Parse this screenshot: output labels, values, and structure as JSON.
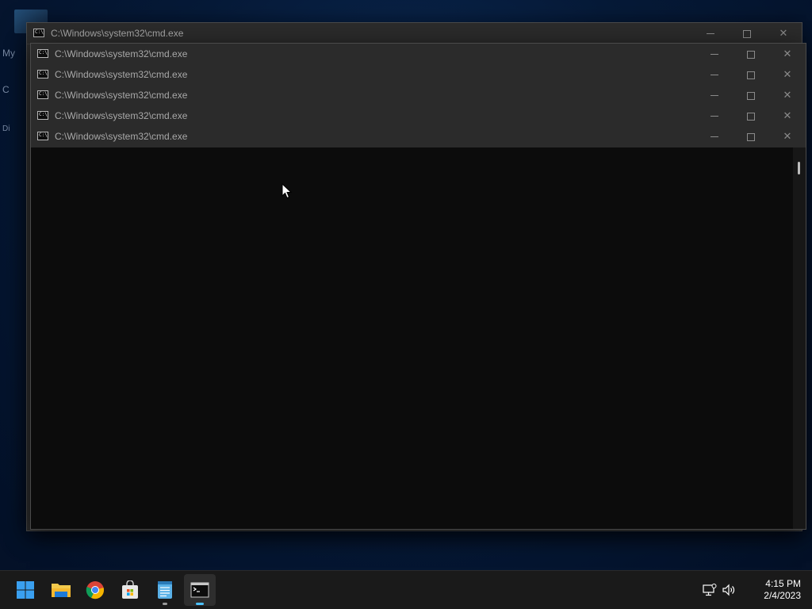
{
  "desktop": {
    "peek_texts": [
      "My",
      "C",
      "Di"
    ]
  },
  "windows": [
    {
      "title": "C:\\Windows\\system32\\cmd.exe"
    },
    {
      "title": "C:\\Windows\\system32\\cmd.exe"
    },
    {
      "title": "C:\\Windows\\system32\\cmd.exe"
    },
    {
      "title": "C:\\Windows\\system32\\cmd.exe"
    },
    {
      "title": "C:\\Windows\\system32\\cmd.exe"
    },
    {
      "title": "C:\\Windows\\system32\\cmd.exe"
    }
  ],
  "cmd_icon_text": "C:\\_",
  "taskbar": {
    "apps": [
      {
        "name": "start-button",
        "icon": "windows-logo-icon"
      },
      {
        "name": "file-explorer-button",
        "icon": "folder-icon"
      },
      {
        "name": "chrome-button",
        "icon": "chrome-icon"
      },
      {
        "name": "microsoft-store-button",
        "icon": "store-icon"
      },
      {
        "name": "notepad-button",
        "icon": "notepad-icon"
      },
      {
        "name": "command-prompt-button",
        "icon": "terminal-icon"
      }
    ],
    "time": "4:15 PM",
    "date": "2/4/2023"
  },
  "colors": {
    "accent": "#4cc2ff",
    "console_bg": "#0c0c0c",
    "titlebar_bg": "#2b2b2b"
  }
}
